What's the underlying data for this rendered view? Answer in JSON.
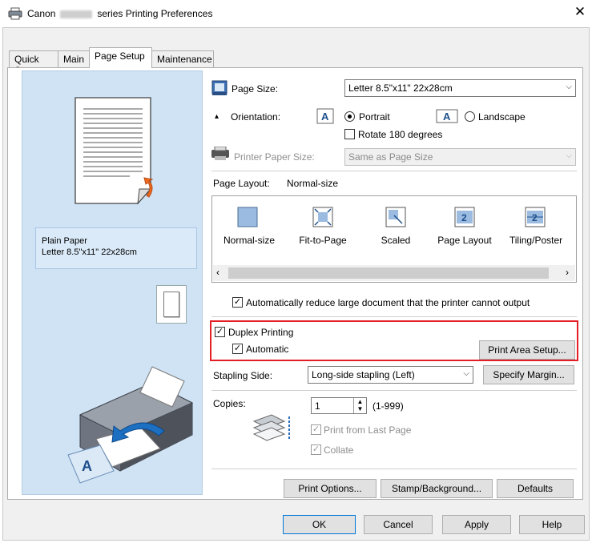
{
  "window": {
    "title_prefix": "Canon",
    "title_suffix": "series Printing Preferences",
    "close_label": "✕"
  },
  "tabs": [
    {
      "label": "Quick Setup"
    },
    {
      "label": "Main"
    },
    {
      "label": "Page Setup"
    },
    {
      "label": "Maintenance"
    }
  ],
  "preview": {
    "paper_type": "Plain Paper",
    "paper_size": "Letter 8.5\"x11\" 22x28cm"
  },
  "page_size": {
    "label": "Page Size:",
    "value": "Letter 8.5\"x11\" 22x28cm"
  },
  "orientation": {
    "label": "Orientation:",
    "portrait": "Portrait",
    "landscape": "Landscape",
    "rotate_180": "Rotate 180 degrees",
    "selected": "Portrait"
  },
  "printer_paper_size": {
    "label": "Printer Paper Size:",
    "value": "Same as Page Size"
  },
  "page_layout": {
    "label": "Page Layout:",
    "current": "Normal-size",
    "options": [
      {
        "label": "Normal-size"
      },
      {
        "label": "Fit-to-Page"
      },
      {
        "label": "Scaled"
      },
      {
        "label": "Page Layout"
      },
      {
        "label": "Tiling/Poster"
      }
    ]
  },
  "auto_reduce": {
    "label": "Automatically reduce large document that the printer cannot output",
    "checked": true
  },
  "duplex": {
    "label": "Duplex Printing",
    "checked": true,
    "automatic_label": "Automatic",
    "automatic_checked": true,
    "print_area_button": "Print Area Setup..."
  },
  "stapling": {
    "label": "Stapling Side:",
    "value": "Long-side stapling (Left)",
    "margin_button": "Specify Margin..."
  },
  "copies": {
    "label": "Copies:",
    "value": "1",
    "range": "(1-999)",
    "print_from_last": "Print from Last Page",
    "collate": "Collate"
  },
  "bottom_buttons": {
    "print_options": "Print Options...",
    "stamp_background": "Stamp/Background...",
    "defaults": "Defaults"
  },
  "dialog_buttons": {
    "ok": "OK",
    "cancel": "Cancel",
    "apply": "Apply",
    "help": "Help"
  },
  "colors": {
    "highlight_border": "#e31e24",
    "preview_pane": "#cfe3f4",
    "focus_border": "#0078d7"
  }
}
